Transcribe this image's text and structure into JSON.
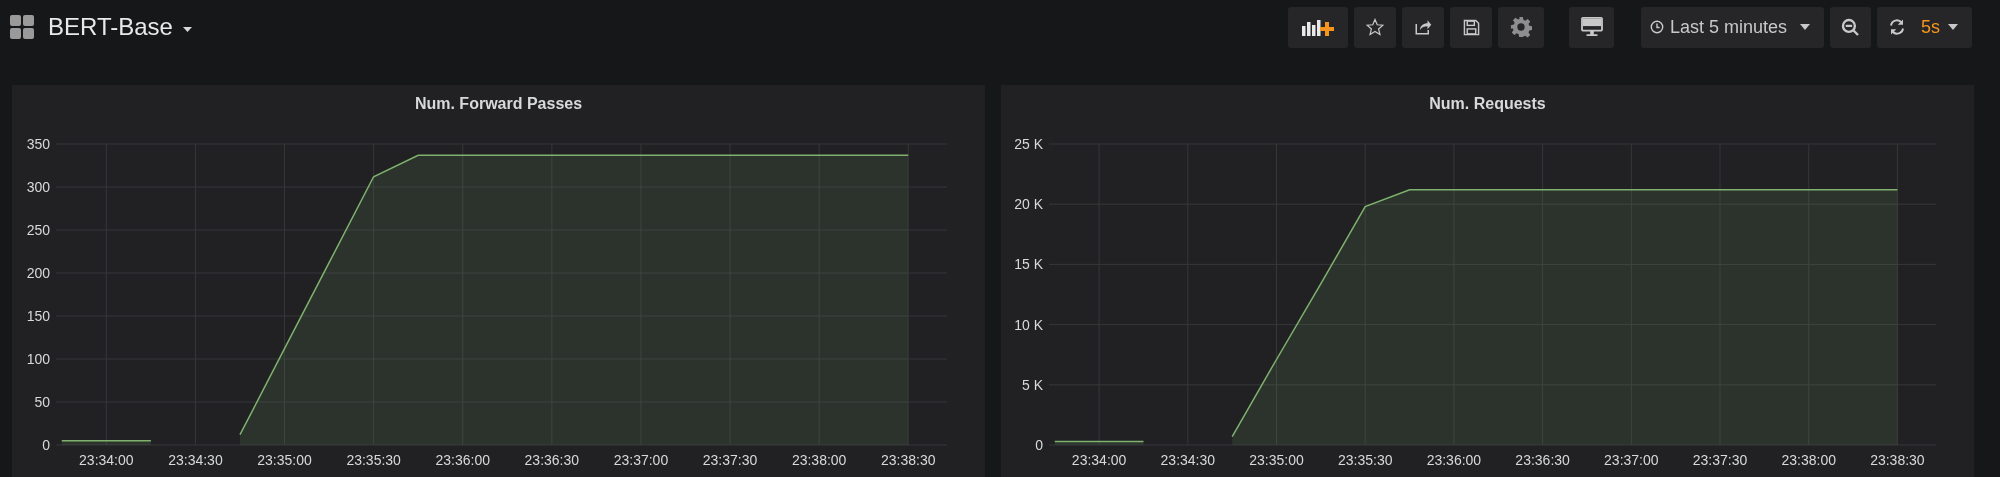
{
  "dashboard": {
    "title": "BERT-Base"
  },
  "toolbar": {
    "time_range": "Last 5 minutes",
    "refresh_interval": "5s"
  },
  "panels": [
    {
      "title": "Num. Forward Passes",
      "chart_data": {
        "type": "area",
        "categories": [
          null,
          "23:34:00",
          null,
          "23:34:30",
          null,
          "23:35:00",
          null,
          "23:35:30",
          null,
          "23:36:00",
          null,
          "23:36:30",
          null,
          "23:37:00",
          null,
          "23:37:30",
          null,
          "23:38:00",
          null,
          "23:38:30"
        ],
        "series": [
          {
            "color": "#7eb26d",
            "values": [
              5,
              5,
              5,
              null,
              12,
              112,
              212,
              312,
              337,
              337,
              337,
              337,
              337,
              337,
              337,
              337,
              337,
              337,
              337,
              337
            ]
          }
        ],
        "grid": true,
        "ylim": [
          0,
          350
        ],
        "yticks": [
          0,
          50,
          100,
          150,
          200,
          250,
          300,
          350
        ]
      }
    },
    {
      "title": "Num. Requests",
      "chart_data": {
        "type": "area",
        "categories": [
          null,
          "23:34:00",
          null,
          "23:34:30",
          null,
          "23:35:00",
          null,
          "23:35:30",
          null,
          "23:36:00",
          null,
          "23:36:30",
          null,
          "23:37:00",
          null,
          "23:37:30",
          null,
          "23:38:00",
          null,
          "23:38:30"
        ],
        "series": [
          {
            "color": "#7eb26d",
            "values": [
              300,
              300,
              300,
              null,
              700,
              7100,
              13400,
              19800,
              21200,
              21200,
              21200,
              21200,
              21200,
              21200,
              21200,
              21200,
              21200,
              21200,
              21200,
              21200
            ]
          }
        ],
        "grid": true,
        "ylim": [
          0,
          25000
        ],
        "yticks": [
          {
            "value": 0,
            "label": "0"
          },
          {
            "value": 5000,
            "label": "5 K"
          },
          {
            "value": 10000,
            "label": "10 K"
          },
          {
            "value": 15000,
            "label": "15 K"
          },
          {
            "value": 20000,
            "label": "20 K"
          },
          {
            "value": 25000,
            "label": "25 K"
          }
        ]
      }
    }
  ]
}
